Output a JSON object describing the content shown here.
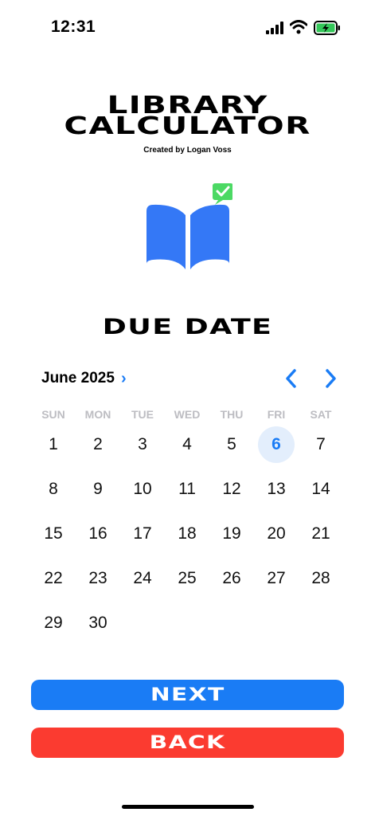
{
  "status_bar": {
    "time": "12:31"
  },
  "header": {
    "title_line1": "LIBRARY",
    "title_line2": "CALCULATOR",
    "subtitle": "Created by Logan Voss"
  },
  "heading": "DUE DATE",
  "calendar": {
    "month_label": "June 2025",
    "month_chevron": "›",
    "weekdays": [
      "SUN",
      "MON",
      "TUE",
      "WED",
      "THU",
      "FRI",
      "SAT"
    ],
    "leading_blanks": 0,
    "days": [
      "1",
      "2",
      "3",
      "4",
      "5",
      "6",
      "7",
      "8",
      "9",
      "10",
      "11",
      "12",
      "13",
      "14",
      "15",
      "16",
      "17",
      "18",
      "19",
      "20",
      "21",
      "22",
      "23",
      "24",
      "25",
      "26",
      "27",
      "28",
      "29",
      "30"
    ],
    "selected_day": "6"
  },
  "buttons": {
    "next_label": "NEXT",
    "back_label": "BACK"
  },
  "colors": {
    "accent": "#1a7cf5",
    "back": "#fb3b30",
    "selected_bg": "#e3eefc",
    "check_badge": "#4cd964"
  },
  "icons": [
    "signal-icon",
    "wifi-icon",
    "battery-charging-icon",
    "open-book-icon",
    "checkmark-badge-icon",
    "chevron-left-icon",
    "chevron-right-icon"
  ]
}
